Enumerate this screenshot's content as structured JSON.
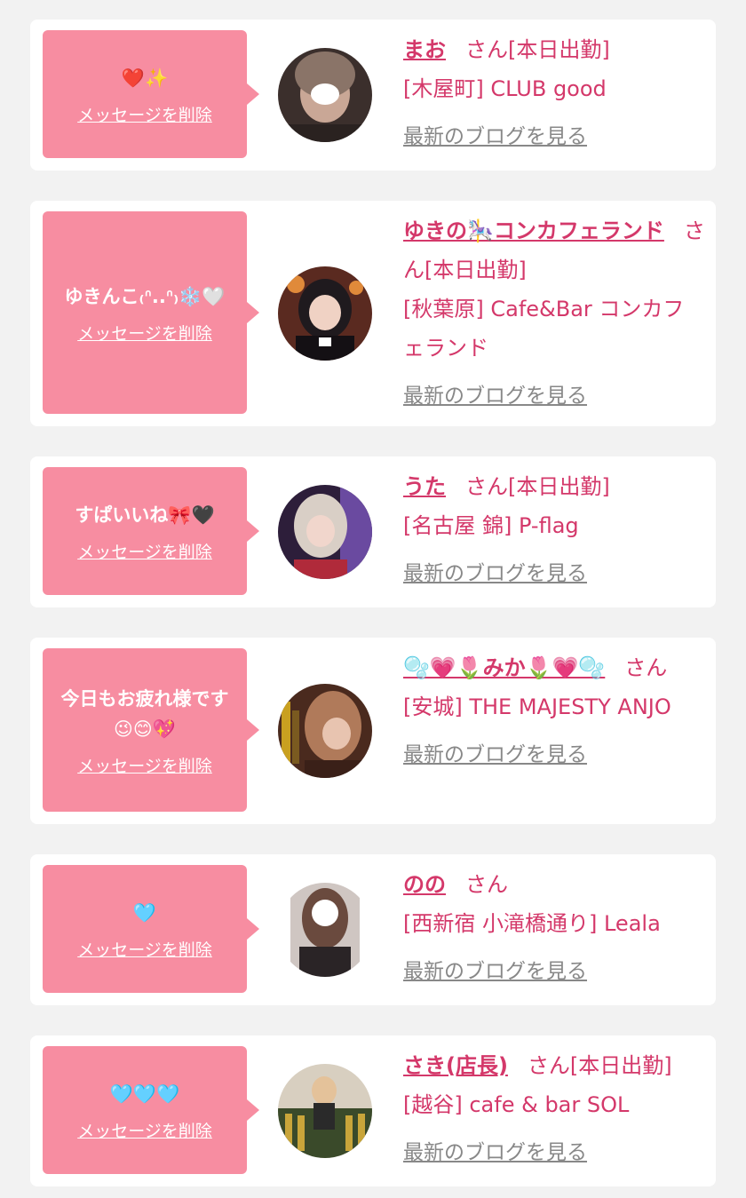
{
  "colors": {
    "background": "#f2f2f2",
    "card": "#ffffff",
    "bubble": "#f78da1",
    "accent": "#d4386a",
    "muted": "#888888"
  },
  "delete_label": "メッセージを削除",
  "blog_label": "最新のブログを見る",
  "entries": [
    {
      "message": "❤️✨",
      "name": "まお",
      "status": "さん[本日出勤]",
      "shop": "[木屋町] CLUB good",
      "avatar_icon": "profile-photo"
    },
    {
      "message": "ゆきんこ₍ᐢ..ᐢ₎❄️🤍",
      "name": "ゆきの🎠コンカフェランド",
      "status": "さん[本日出勤]",
      "shop": "[秋葉原] Cafe&Bar コンカフェランド",
      "avatar_icon": "profile-photo"
    },
    {
      "message": "すぱいいね🎀🖤",
      "name": "うた",
      "status": "さん[本日出勤]",
      "shop": "[名古屋 錦] P-flag",
      "avatar_icon": "profile-photo"
    },
    {
      "message": "今日もお疲れ様です😉😊💖",
      "name": "🫧💗🌷みか🌷💗🫧",
      "status": "さん",
      "shop": "[安城] THE MAJESTY ANJO",
      "avatar_icon": "profile-photo"
    },
    {
      "message": "🩵",
      "name": "のの",
      "status": "さん",
      "shop": "[西新宿 小滝橋通り] Leala",
      "avatar_icon": "profile-photo"
    },
    {
      "message": "🩵🩵🩵",
      "name": "さき(店長)",
      "status": "さん[本日出勤]",
      "shop": "[越谷] cafe & bar SOL",
      "avatar_icon": "profile-photo"
    }
  ]
}
